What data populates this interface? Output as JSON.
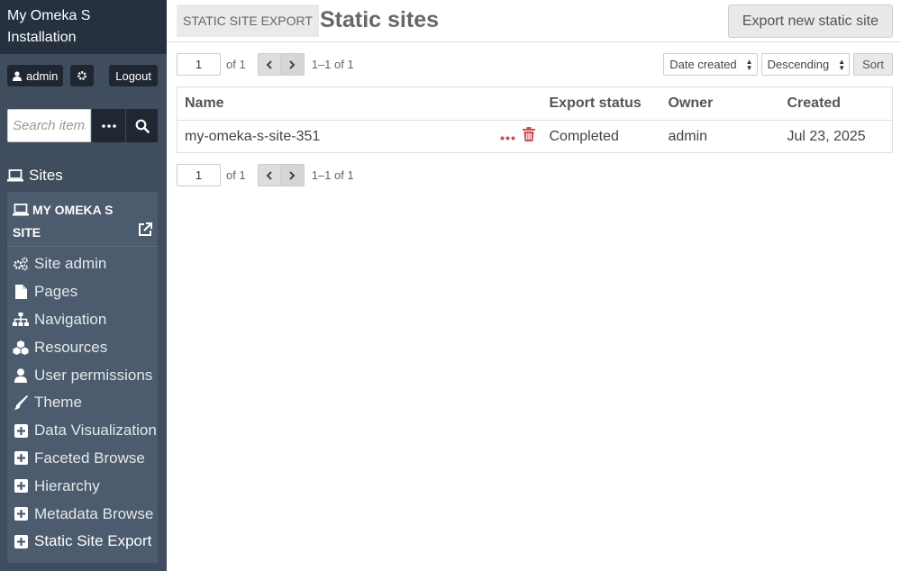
{
  "sidebar": {
    "install_title": "My Omeka S Installation",
    "user": "admin",
    "logout_label": "Logout",
    "search": {
      "placeholder": "Search items",
      "options_label": "•••"
    },
    "sites_label": "Sites",
    "site_name": "My Omeka S Site",
    "nav_items": [
      {
        "label": "Site admin",
        "icon": "cogs-icon"
      },
      {
        "label": "Pages",
        "icon": "file-icon"
      },
      {
        "label": "Navigation",
        "icon": "sitemap-icon"
      },
      {
        "label": "Resources",
        "icon": "cubes-icon"
      },
      {
        "label": "User permissions",
        "icon": "user-icon"
      },
      {
        "label": "Theme",
        "icon": "paintbrush-icon"
      },
      {
        "label": "Data Visualization",
        "icon": "plus-square-icon"
      },
      {
        "label": "Faceted Browse",
        "icon": "plus-square-icon"
      },
      {
        "label": "Hierarchy",
        "icon": "plus-square-icon"
      },
      {
        "label": "Metadata Browse",
        "icon": "plus-square-icon"
      },
      {
        "label": "Static Site Export",
        "icon": "plus-square-icon",
        "active": true
      }
    ]
  },
  "header": {
    "breadcrumb": "Static Site Export",
    "title": "Static sites",
    "export_button": "Export new static site"
  },
  "pagination": {
    "page_value": "1",
    "of_total": "of 1",
    "range": "1–1 of 1"
  },
  "sort": {
    "sort_by": "Date created",
    "sort_order": "Descending",
    "sort_button": "Sort"
  },
  "table": {
    "headers": [
      "Name",
      "Export status",
      "Owner",
      "Created"
    ],
    "rows": [
      {
        "name": "my-omeka-s-site-351",
        "status": "Completed",
        "owner": "admin",
        "created": "Jul 23, 2025"
      }
    ]
  },
  "colors": {
    "sidebar_dark": "#25313f",
    "sidebar": "#3f4d5e",
    "site_panel": "#4c5b6d",
    "link_red": "#a91919"
  }
}
